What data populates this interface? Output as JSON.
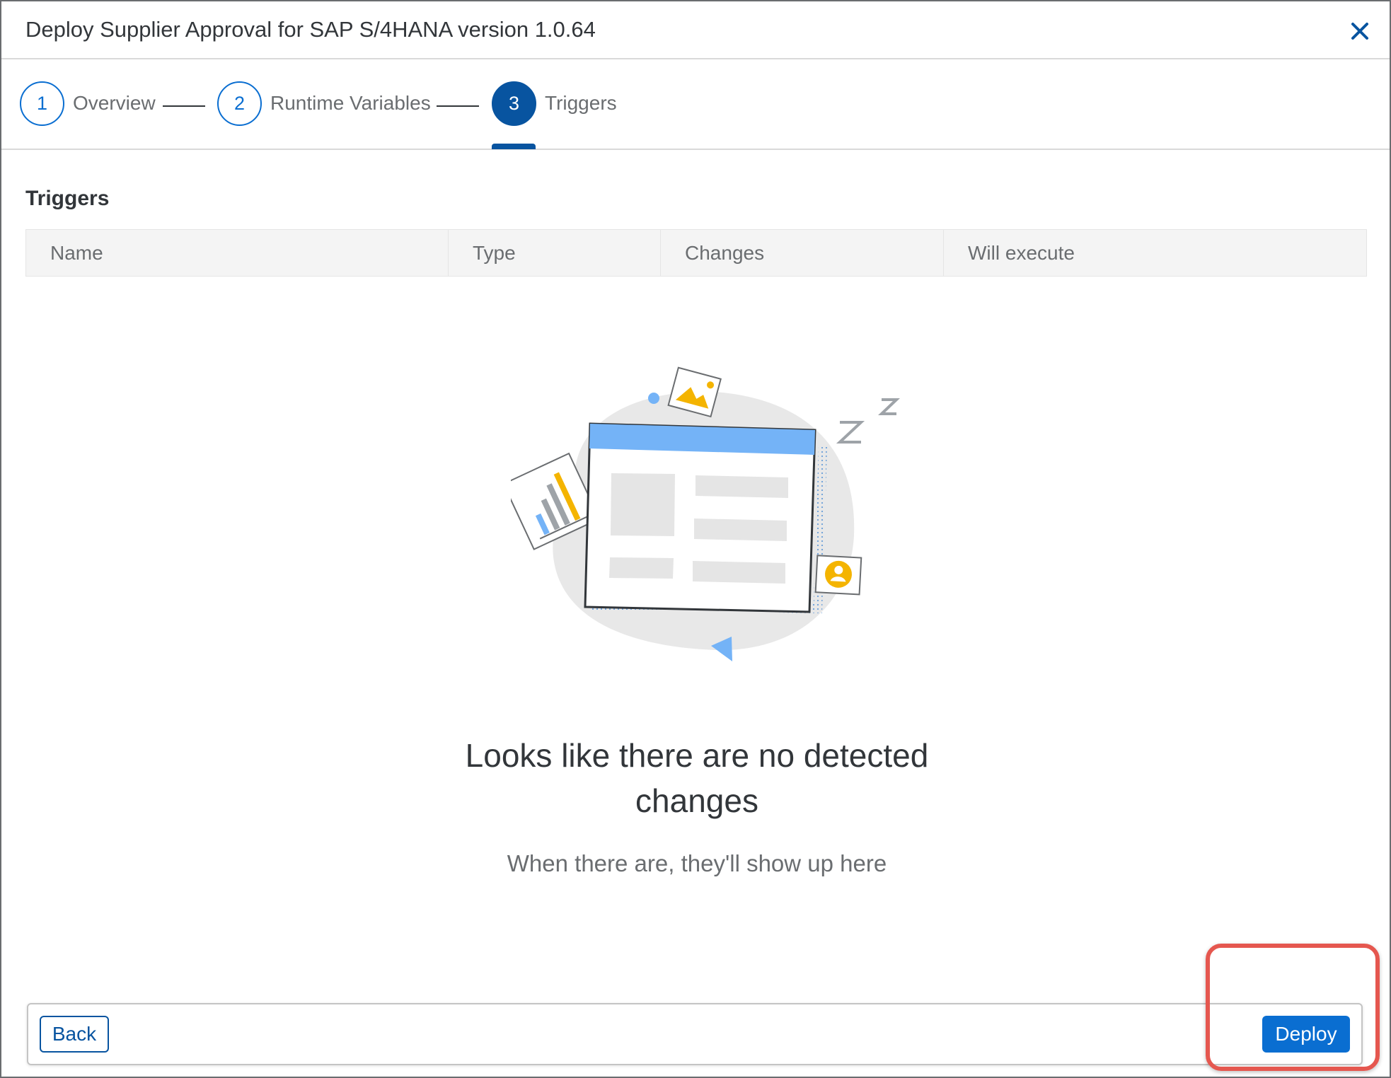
{
  "dialog": {
    "title": "Deploy Supplier Approval for SAP S/4HANA version 1.0.64"
  },
  "stepper": {
    "steps": [
      {
        "number": "1",
        "label": "Overview"
      },
      {
        "number": "2",
        "label": "Runtime Variables"
      },
      {
        "number": "3",
        "label": "Triggers"
      }
    ],
    "active_step": 3
  },
  "section": {
    "title": "Triggers"
  },
  "table": {
    "columns": [
      "Name",
      "Type",
      "Changes",
      "Will execute"
    ],
    "rows": []
  },
  "empty_state": {
    "title": "Looks like there are no detected changes",
    "subtitle": "When there are, they'll show up here"
  },
  "footer": {
    "back_label": "Back",
    "deploy_label": "Deploy"
  },
  "colors": {
    "primary": "#0a6ed1",
    "primary_dark": "#0854a0",
    "highlight": "#e5574f",
    "illustration_accent": "#f4b400",
    "illustration_blue": "#74b3f7"
  },
  "icons": {
    "close": "close-icon",
    "illustration": "empty-state-illustration"
  }
}
